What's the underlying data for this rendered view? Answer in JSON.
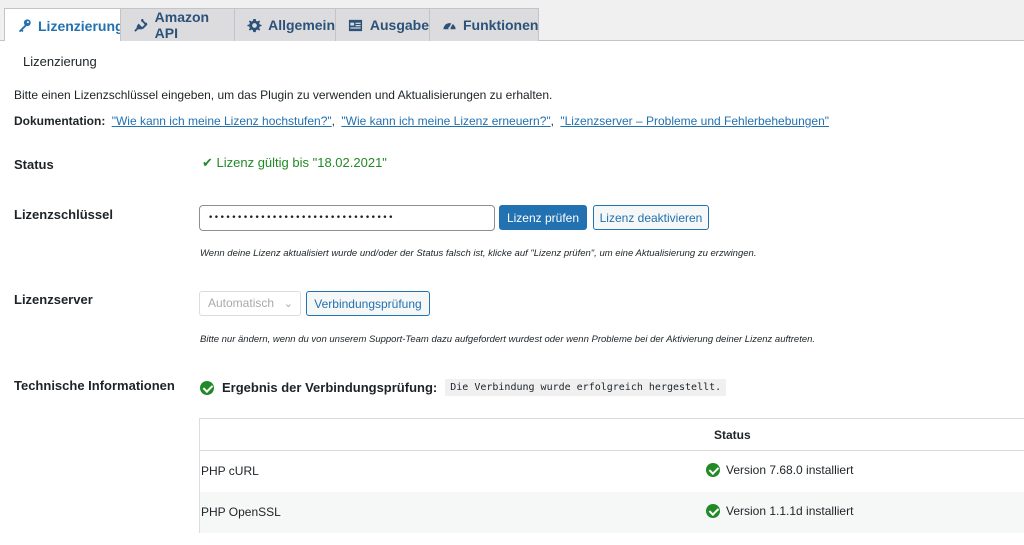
{
  "tabs": [
    {
      "label": "Lizenzierung",
      "icon": "key-icon",
      "active": true
    },
    {
      "label": "Amazon API",
      "icon": "plug-icon",
      "active": false
    },
    {
      "label": "Allgemein",
      "icon": "gear-icon",
      "active": false
    },
    {
      "label": "Ausgabe",
      "icon": "layout-icon",
      "active": false
    },
    {
      "label": "Funktionen",
      "icon": "dashboard-icon",
      "active": false
    }
  ],
  "panel": {
    "title": "Lizenzierung",
    "intro": "Bitte einen Lizenzschlüssel eingeben, um das Plugin zu verwenden und Aktualisierungen zu erhalten.",
    "docs_label": "Dokumentation:",
    "docs_links": [
      "\"Wie kann ich meine Lizenz hochstufen?\"",
      "\"Wie kann ich meine Lizenz erneuern?\"",
      "\"Lizenzserver – Probleme und Fehlerbehebungen\""
    ],
    "docs_separator": ","
  },
  "status": {
    "label": "Status",
    "value": "✔ Lizenz gültig bis \"18.02.2021\""
  },
  "license": {
    "label": "Lizenzschlüssel",
    "value": "••••••••••••••••••••••••••••••••",
    "check_button": "Lizenz prüfen",
    "deactivate_button": "Lizenz deaktivieren",
    "hint": "Wenn deine Lizenz aktualisiert wurde und/oder der Status falsch ist, klicke auf \"Lizenz prüfen\", um eine Aktualisierung zu erzwingen."
  },
  "server": {
    "label": "Lizenzserver",
    "select_value": "Automatisch",
    "test_button": "Verbindungsprüfung",
    "hint": "Bitte nur ändern, wenn du von unserem Support-Team dazu aufgefordert wurdest oder wenn Probleme bei der Aktivierung deiner Lizenz auftreten."
  },
  "tech": {
    "label": "Technische Informationen",
    "result_label": "Ergebnis der Verbindungsprüfung:",
    "result_value": "Die Verbindung wurde erfolgreich hergestellt.",
    "table": {
      "header_status": "Status",
      "rows": [
        {
          "name": "PHP cURL",
          "status": "Version 7.68.0 installiert"
        },
        {
          "name": "PHP OpenSSL",
          "status": "Version 1.1.1d installiert"
        }
      ]
    }
  },
  "colors": {
    "accent": "#2271b1",
    "success": "#218a26"
  }
}
